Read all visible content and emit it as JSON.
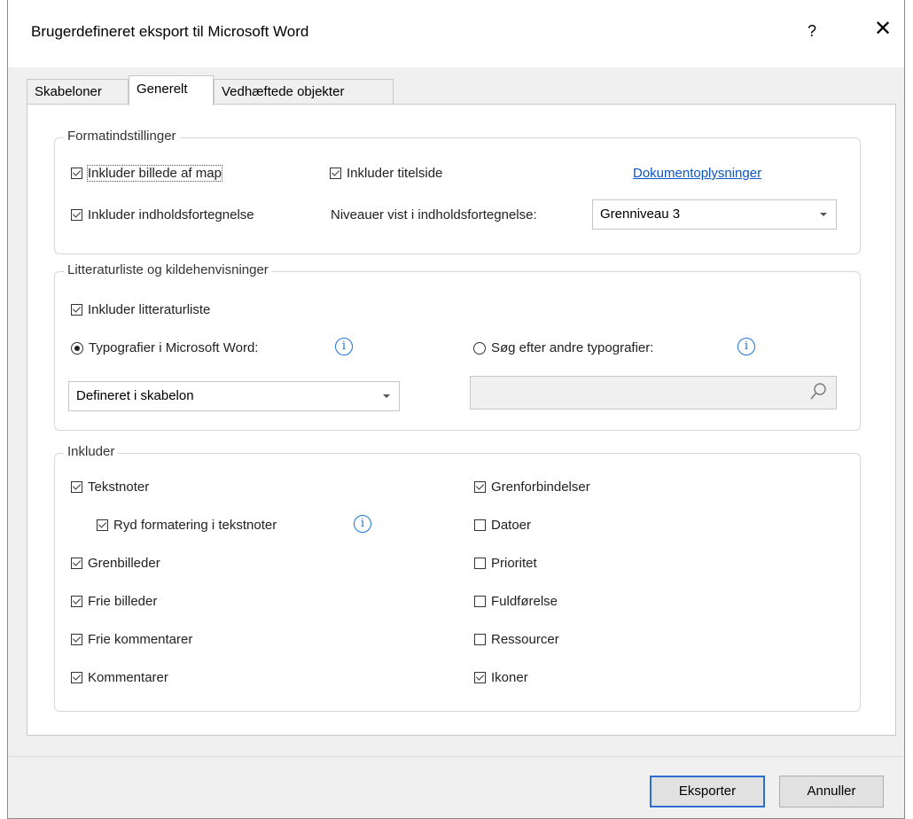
{
  "dialog": {
    "title": "Brugerdefineret eksport til Microsoft Word",
    "help": "?",
    "close": "✕"
  },
  "tabs": [
    "Skabeloner",
    "Generelt",
    "Vedhæftede objekter"
  ],
  "format": {
    "legend": "Formatindstillinger",
    "include_image": {
      "label": "Inkluder billede af map",
      "checked": true
    },
    "include_title": {
      "label": "Inkluder titelside",
      "checked": true
    },
    "doc_info_link": "Dokumentoplysninger",
    "include_toc": {
      "label": "Inkluder indholdsfortegnelse",
      "checked": true
    },
    "levels_label": "Niveauer vist i indholdsfortegnelse:",
    "levels_value": "Grenniveau 3"
  },
  "bibliography": {
    "legend": "Litteraturliste og kildehenvisninger",
    "include_bib": {
      "label": "Inkluder litteraturliste",
      "checked": true
    },
    "word_styles": {
      "label": "Typografier i Microsoft Word:",
      "selected": true
    },
    "other_styles": {
      "label": "Søg efter andre typografier:",
      "selected": false
    },
    "style_value": "Defineret i skabelon",
    "search_value": ""
  },
  "include": {
    "legend": "Inkluder",
    "left": [
      {
        "label": "Tekstnoter",
        "checked": true
      },
      {
        "label": "Ryd formatering i tekstnoter",
        "checked": true
      },
      {
        "label": "Grenbilleder",
        "checked": true
      },
      {
        "label": "Frie billeder",
        "checked": true
      },
      {
        "label": "Frie kommentarer",
        "checked": true
      },
      {
        "label": "Kommentarer",
        "checked": true
      }
    ],
    "right": [
      {
        "label": "Grenforbindelser",
        "checked": true
      },
      {
        "label": "Datoer",
        "checked": false
      },
      {
        "label": "Prioritet",
        "checked": false
      },
      {
        "label": "Fuldførelse",
        "checked": false
      },
      {
        "label": "Ressourcer",
        "checked": false
      },
      {
        "label": "Ikoner",
        "checked": true
      }
    ]
  },
  "buttons": {
    "export": "Eksporter",
    "cancel": "Annuller"
  },
  "colors": {
    "accent": "#2b6fd6",
    "link": "#0b55c4",
    "info": "#1a73d9"
  }
}
